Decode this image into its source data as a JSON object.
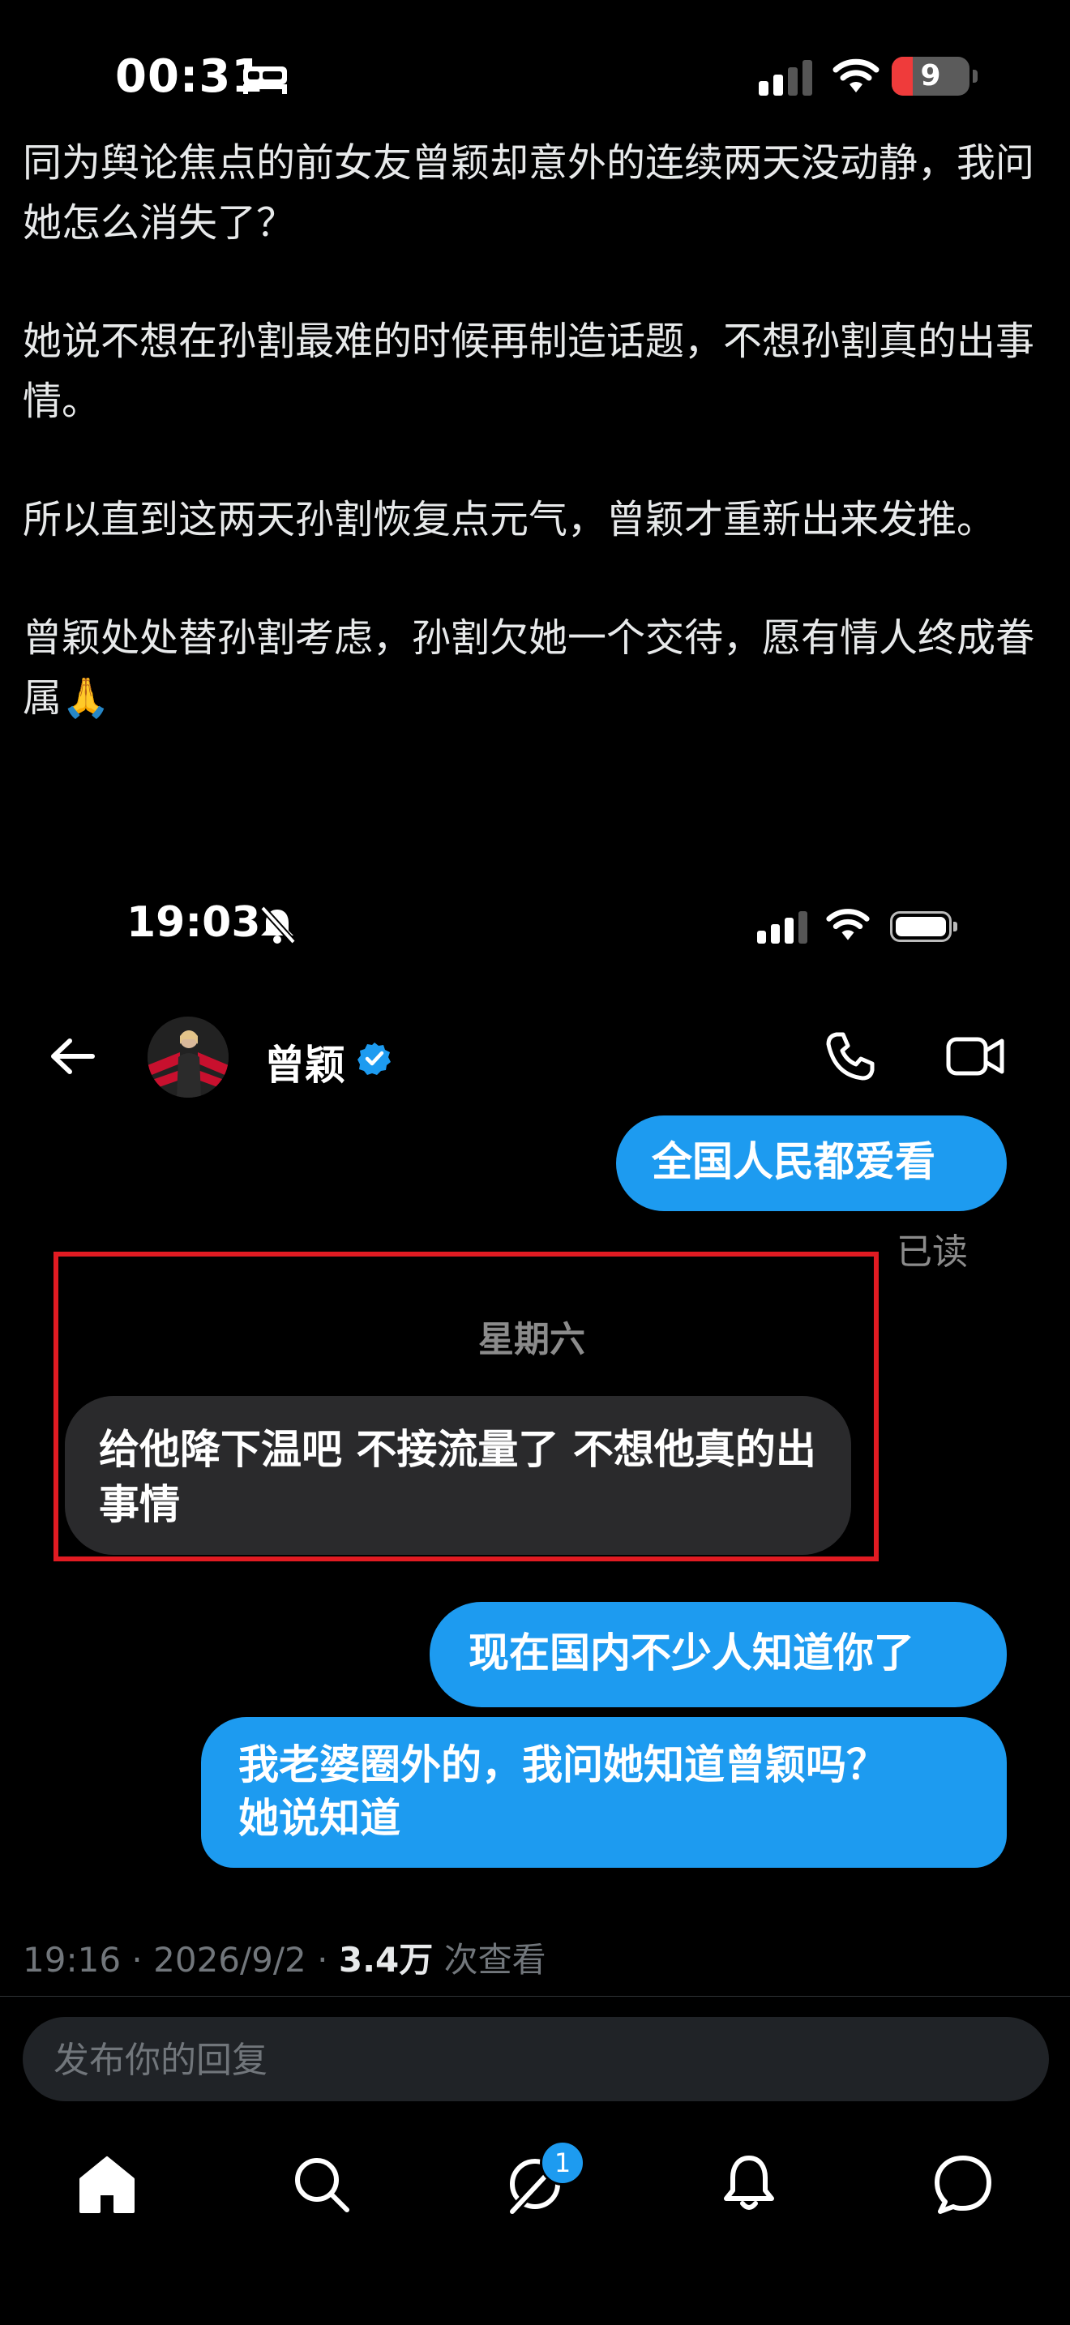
{
  "status_bar": {
    "time": "00:31",
    "battery_level": "9",
    "battery_color": "#ef3b3b"
  },
  "tweet": {
    "paragraphs": [
      "同为舆论焦点的前女友曾颖却意外的连续两天没动静，我问她怎么消失了？",
      "她说不想在孙割最难的时候再制造话题，不想孙割真的出事情。",
      "所以直到这两天孙割恢复点元气，曾颖才重新出来发推。",
      "曾颖处处替孙割考虑，孙割欠她一个交待，愿有情人终成眷属🙏"
    ]
  },
  "embedded_screenshot": {
    "status_time": "19:03",
    "contact_name": "曾颖",
    "messages": {
      "sent_1": "全国人民都爱看",
      "read_status": "已读",
      "day_separator": "星期六",
      "received_1": "给他降下温吧 不接流量了 不想他真的出事情",
      "sent_2": "现在国内不少人知道你了",
      "sent_3_line1": "我老婆圈外的，我问她知道曾颖吗？",
      "sent_3_line2": "她说知道"
    },
    "accent_color": "#1d9bf0",
    "highlight_color": "#e11b22"
  },
  "tweet_meta": {
    "time": "19:16",
    "date": "2026/9/2",
    "views": "3.4万",
    "views_label": "次查看",
    "sep": "·"
  },
  "reply": {
    "placeholder": "发布你的回复"
  },
  "nav": {
    "badge_count": "1",
    "items": [
      "home-icon",
      "search-icon",
      "grok-icon",
      "notifications-icon",
      "messages-icon"
    ]
  }
}
